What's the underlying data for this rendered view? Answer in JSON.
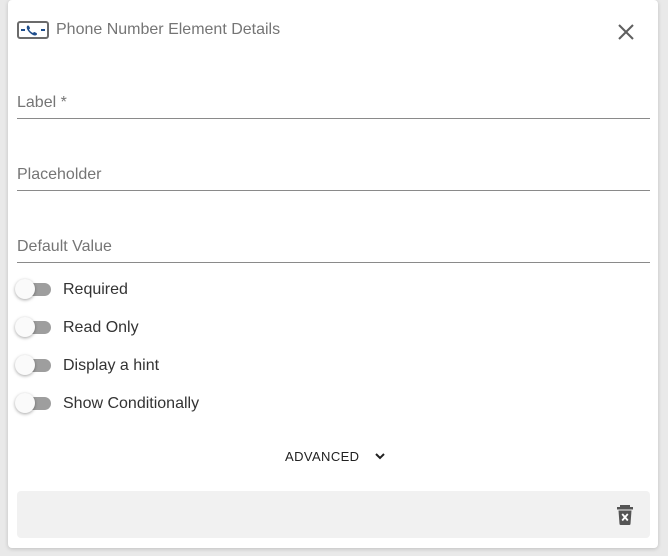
{
  "dialog": {
    "title": "Phone Number Element Details",
    "icon": "phone-number-element-icon",
    "close_icon": "close-icon"
  },
  "fields": [
    {
      "placeholder": "Label *",
      "value": ""
    },
    {
      "placeholder": "Placeholder",
      "value": ""
    },
    {
      "placeholder": "Default Value",
      "value": ""
    }
  ],
  "toggles": [
    {
      "label": "Required",
      "on": false
    },
    {
      "label": "Read Only",
      "on": false
    },
    {
      "label": "Display a hint",
      "on": false
    },
    {
      "label": "Show Conditionally",
      "on": false
    }
  ],
  "advanced": {
    "label": "ADVANCED",
    "icon": "chevron-down-icon"
  },
  "footer": {
    "delete_icon": "delete-icon"
  },
  "colors": {
    "icon_accent": "#1f4e8c",
    "track_off": "#9e9e9e",
    "footer_bg": "#f1f1f1"
  }
}
